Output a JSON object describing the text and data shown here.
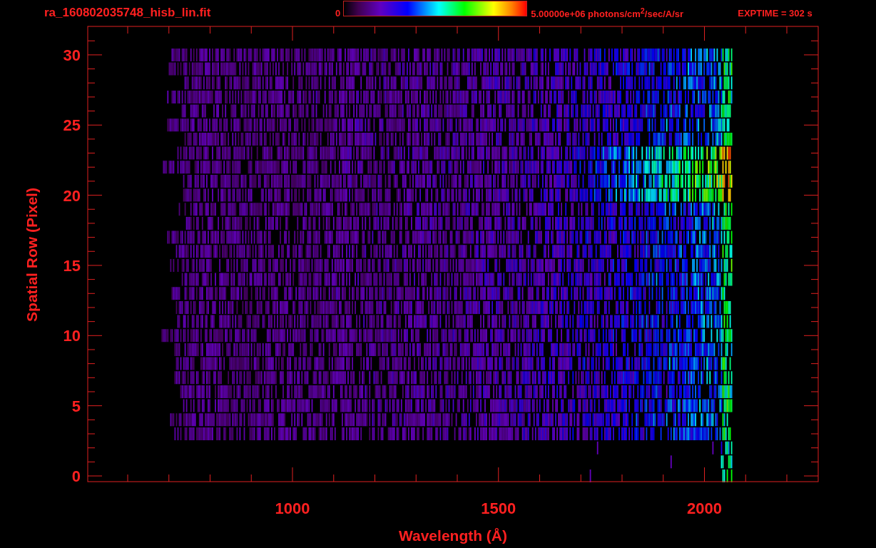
{
  "header": {
    "filename": "ra_160802035748_hisb_lin.fit",
    "colorbar_min": "0",
    "colorbar_max": "5.00000e+06 photons/cm$^{2}$/sec/A/sr",
    "exposure": "EXPTIME = 302 s"
  },
  "plot": {
    "xlabel": "Wavelength (Å)",
    "ylabel": "Spatial Row (Pixel)",
    "yticks": [
      "30",
      "25",
      "20",
      "15",
      "10",
      "5",
      "0"
    ],
    "xticks": [
      "1000",
      "1500",
      "2000"
    ]
  }
}
